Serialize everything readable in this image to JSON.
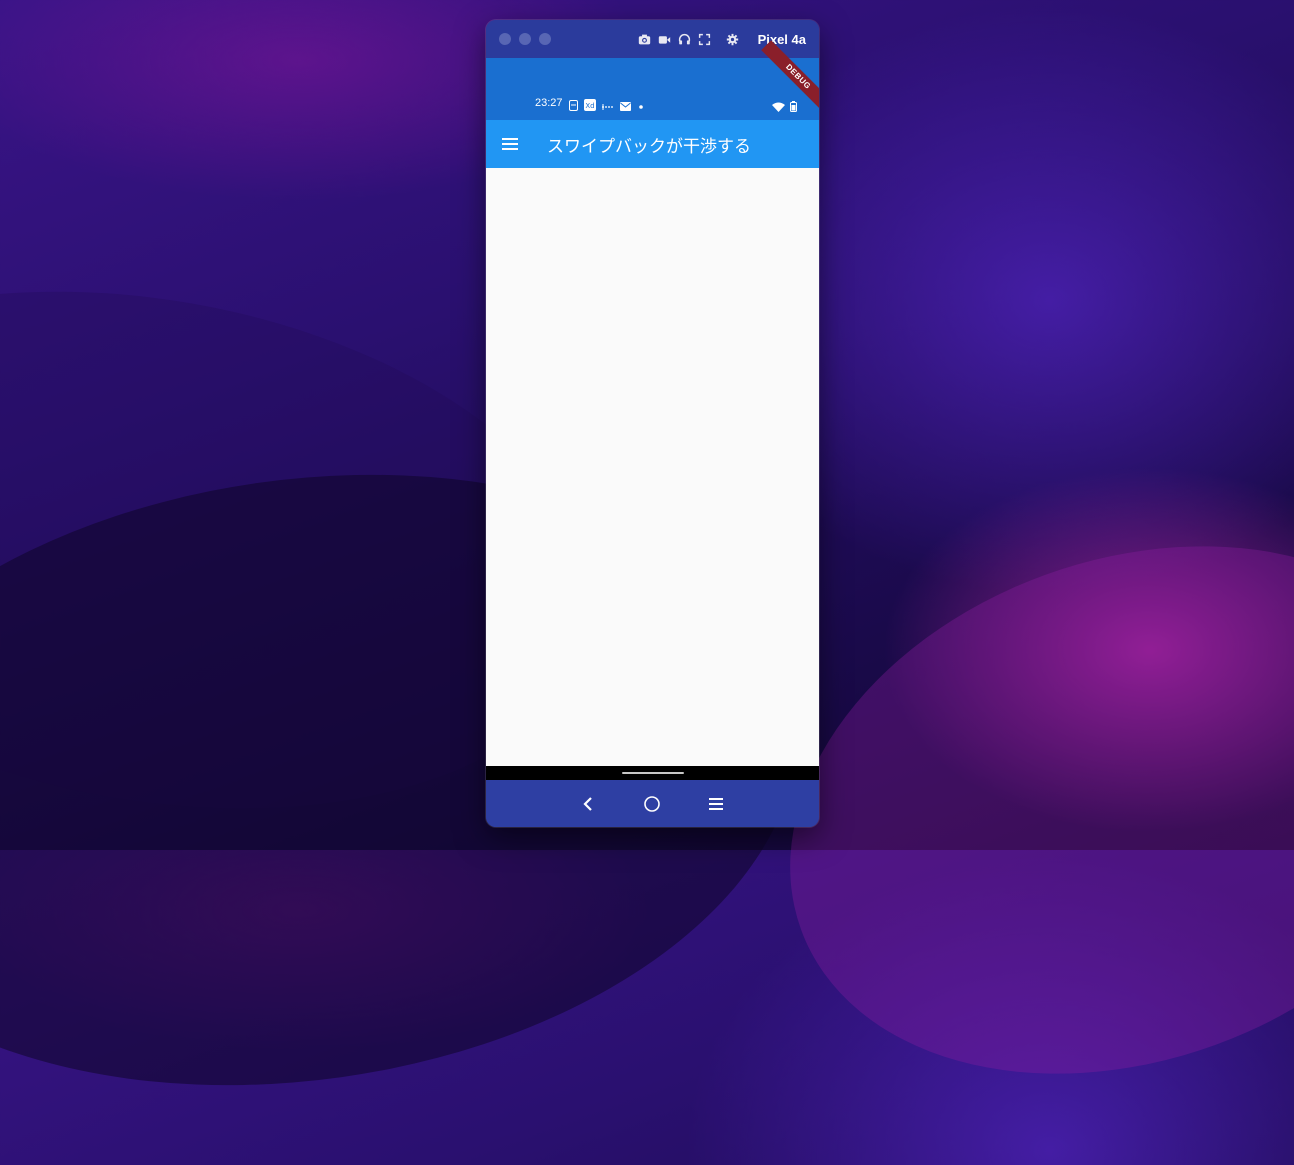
{
  "emulator": {
    "device_name": "Pixel 4a",
    "toolbar_icons": [
      "camera-icon",
      "video-icon",
      "headphones-icon",
      "fullscreen-icon",
      "gear-icon"
    ]
  },
  "status_bar": {
    "time": "23:27",
    "debug_banner": "DEBUG",
    "icons": [
      "sim-icon",
      "xd-app-icon",
      "dashes-icon",
      "mail-icon",
      "dot-icon",
      "wifi-icon",
      "battery-icon"
    ]
  },
  "app_bar": {
    "title": "スワイプバックが干渉する",
    "menu_icon": "hamburger-menu-icon",
    "color": "#2196f3"
  },
  "nav_bar": {
    "buttons": [
      "back-icon",
      "home-icon",
      "recents-icon"
    ]
  }
}
